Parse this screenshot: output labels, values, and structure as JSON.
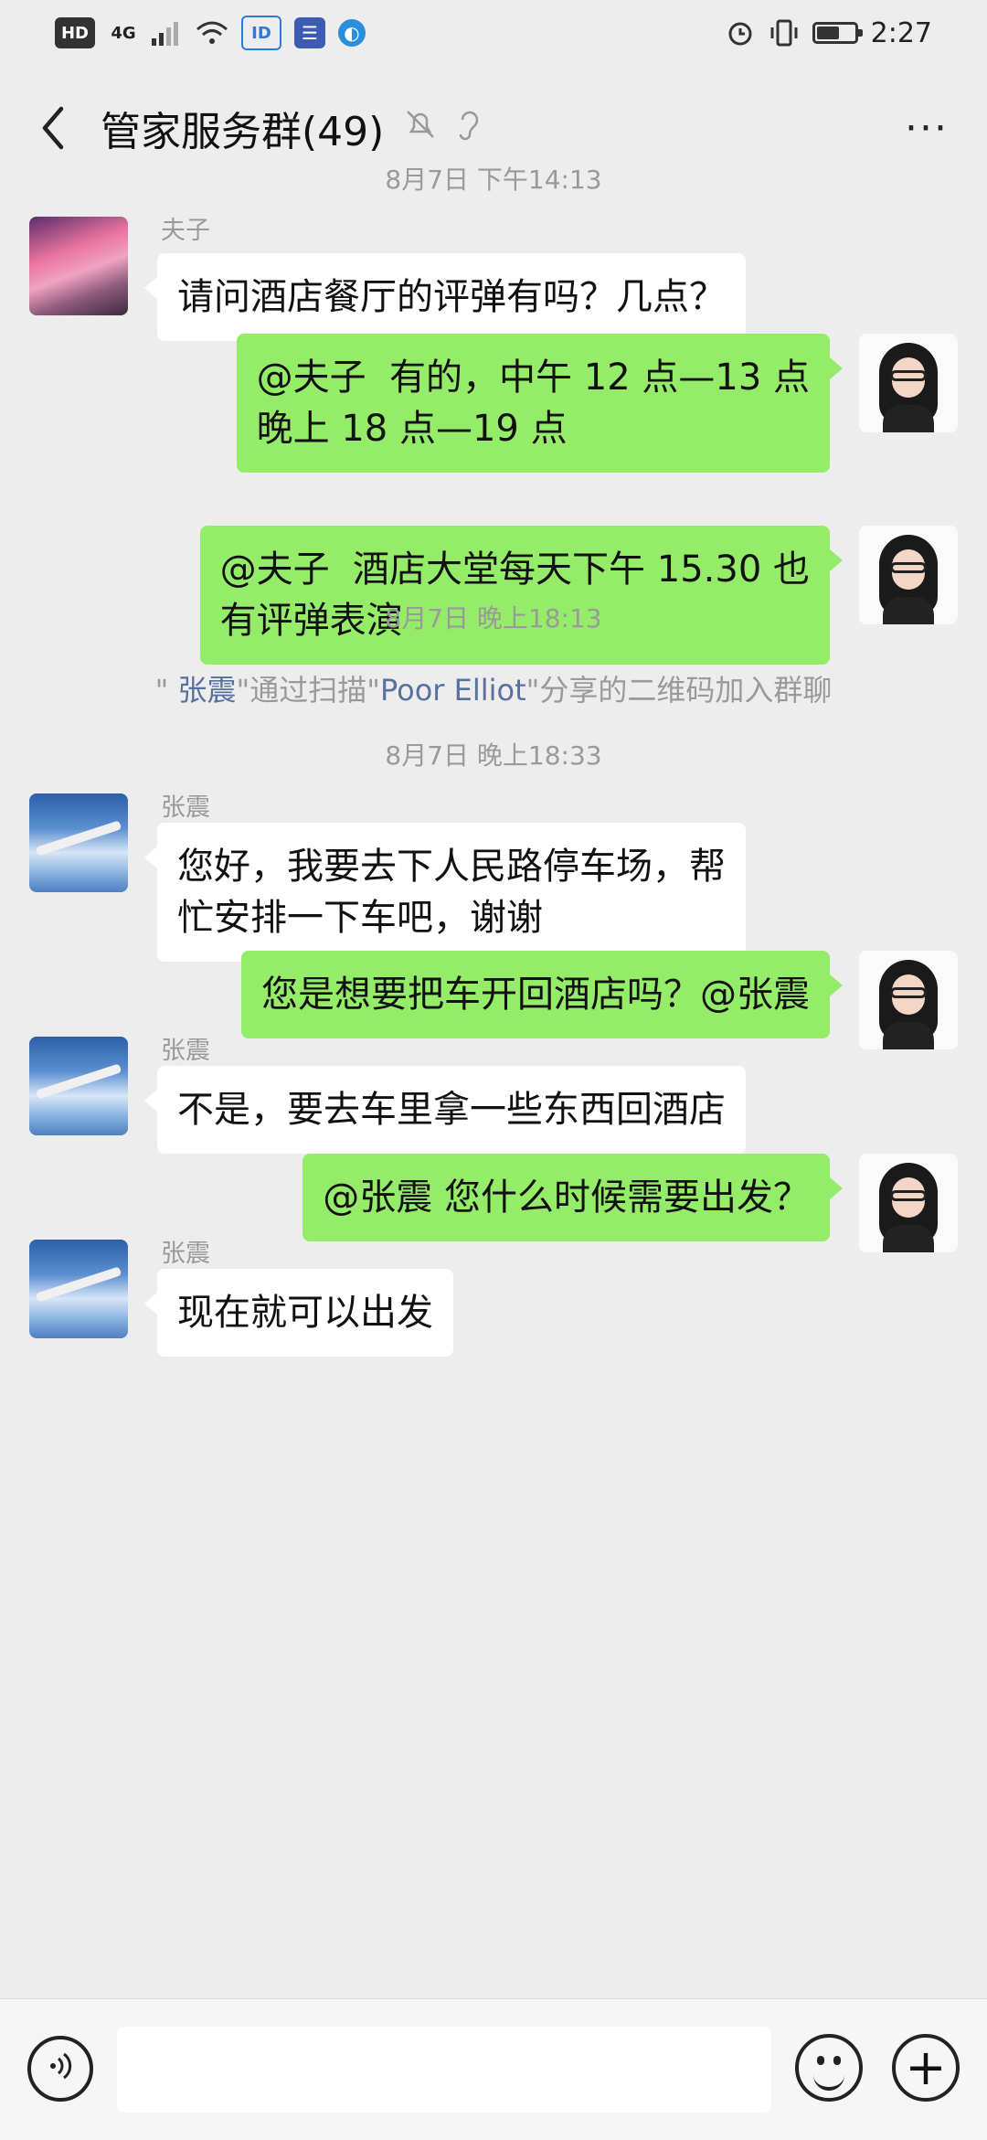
{
  "status_bar": {
    "left_icons": [
      "HD",
      "4G",
      "signal",
      "wifi",
      "ID",
      "gx",
      "globe"
    ],
    "hd_label": "HD",
    "net_label": "4G",
    "id_label": "ID",
    "time": "2:27",
    "battery_level": 0.6
  },
  "header": {
    "title": "管家服务群(49)",
    "more_label": "···"
  },
  "messages": [
    {
      "type": "time",
      "text": "8月7日 下午14:13"
    },
    {
      "type": "in",
      "sender": "夫子",
      "avatar": "cherry-blossom-avatar",
      "text": "请问酒店餐厅的评弹有吗？几点？"
    },
    {
      "type": "out",
      "avatar": "woman-avatar",
      "text": "@夫子  有的，中午 12 点—13 点\n晚上 18 点—19 点"
    },
    {
      "type": "out",
      "avatar": "woman-avatar",
      "text": "@夫子  酒店大堂每天下午 15.30 也\n有评弹表演"
    },
    {
      "type": "time",
      "text": "8月7日 晚上18:13"
    },
    {
      "type": "system",
      "parts": [
        "\" ",
        "张震",
        "\"通过扫描\"",
        "Poor Elliot",
        "\"分享的二维码加入群聊"
      ]
    },
    {
      "type": "time",
      "text": "8月7日 晚上18:33"
    },
    {
      "type": "in",
      "sender": "张震",
      "avatar": "airplane-avatar",
      "text": "您好，我要去下人民路停车场，帮\n忙安排一下车吧，谢谢"
    },
    {
      "type": "out",
      "avatar": "woman-avatar",
      "text": "您是想要把车开回酒店吗？@张震"
    },
    {
      "type": "in",
      "sender": "张震",
      "avatar": "airplane-avatar",
      "text": "不是，要去车里拿一些东西回酒店"
    },
    {
      "type": "out",
      "avatar": "woman-avatar",
      "text": "@张震 您什么时候需要出发？"
    },
    {
      "type": "in",
      "sender": "张震",
      "avatar": "airplane-avatar",
      "text": "现在就可以出发"
    }
  ],
  "input_bar": {
    "voice_icon": "voice-icon",
    "emoji_icon": "emoji-icon",
    "plus_icon": "plus-icon",
    "plus_label": "+"
  },
  "colors": {
    "outgoing_bubble": "#95ec69",
    "incoming_bubble": "#ffffff",
    "background": "#ededed",
    "link_name": "#58719f"
  }
}
